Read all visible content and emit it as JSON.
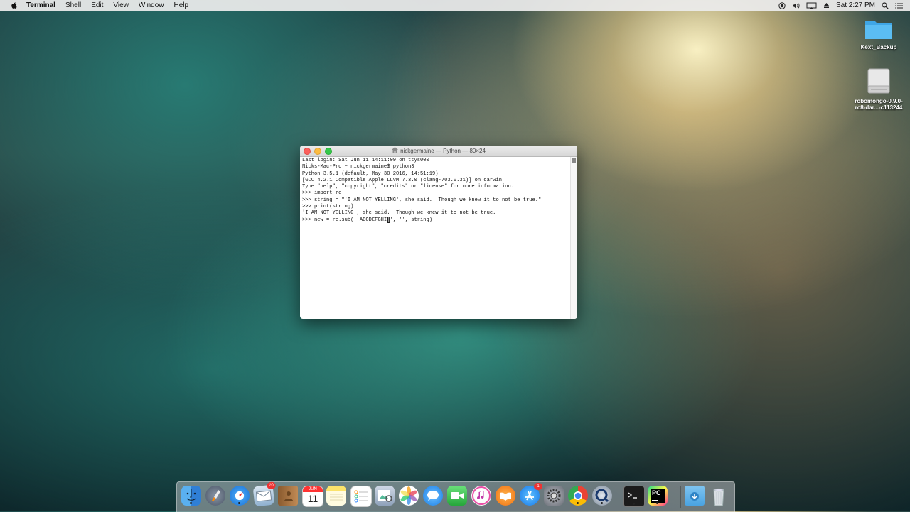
{
  "menubar": {
    "app_name": "Terminal",
    "menus": [
      "Shell",
      "Edit",
      "View",
      "Window",
      "Help"
    ],
    "clock": "Sat 2:27 PM"
  },
  "desktop": {
    "icons": [
      {
        "label": "Kext_Backup"
      },
      {
        "label_line1": "robomongo-0.9.0-",
        "label_line2": "rc8-dar...-c113244"
      }
    ]
  },
  "terminal": {
    "title": "nickgermaine — Python — 80×24",
    "lines": [
      "Last login: Sat Jun 11 14:11:09 on ttys000",
      "Nicks-Mac-Pro:~ nickgermaine$ python3",
      "Python 3.5.1 (default, May 30 2016, 14:51:19)",
      "[GCC 4.2.1 Compatible Apple LLVM 7.3.0 (clang-703.0.31)] on darwin",
      "Type \"help\", \"copyright\", \"credits\" or \"license\" for more information.",
      ">>> import re",
      ">>> string = \"'I AM NOT YELLING', she said.  Though we knew it to not be true.\"",
      ">>> print(string)",
      "'I AM NOT YELLING', she said.  Though we knew it to not be true."
    ],
    "current_line_before_cursor": ">>> new = re.sub('[ABCDEFGHI",
    "cursor_char": "]",
    "current_line_after_cursor": "', '', string)"
  },
  "dock": {
    "items": [
      {
        "name": "Finder",
        "icon": "finder-icon",
        "running": true
      },
      {
        "name": "Launchpad",
        "icon": "launchpad-icon",
        "running": false
      },
      {
        "name": "Safari",
        "icon": "safari-icon",
        "running": true
      },
      {
        "name": "Mail",
        "icon": "mail-icon",
        "running": false,
        "badge": "70"
      },
      {
        "name": "Contacts",
        "icon": "contacts-icon",
        "running": false
      },
      {
        "name": "Calendar",
        "icon": "calendar-icon",
        "running": false,
        "month": "JUN",
        "day": "11"
      },
      {
        "name": "Notes",
        "icon": "notes-icon",
        "running": false
      },
      {
        "name": "Reminders",
        "icon": "reminders-icon",
        "running": false
      },
      {
        "name": "Preview",
        "icon": "preview-icon",
        "running": false
      },
      {
        "name": "Photos",
        "icon": "photos-icon",
        "running": false
      },
      {
        "name": "Messages",
        "icon": "messages-icon",
        "running": false
      },
      {
        "name": "FaceTime",
        "icon": "facetime-icon",
        "running": false
      },
      {
        "name": "iTunes",
        "icon": "itunes-icon",
        "running": false
      },
      {
        "name": "iBooks",
        "icon": "ibooks-icon",
        "running": false
      },
      {
        "name": "App Store",
        "icon": "appstore-icon",
        "running": false,
        "badge": "1"
      },
      {
        "name": "System Preferences",
        "icon": "sysprefs-icon",
        "running": false
      },
      {
        "name": "Chrome",
        "icon": "chrome-icon",
        "running": true
      },
      {
        "name": "QuickTime",
        "icon": "quicktime-icon",
        "running": true
      },
      {
        "name": "Terminal",
        "icon": "terminal-icon",
        "running": true
      },
      {
        "name": "PyCharm",
        "icon": "pycharm-icon",
        "running": true
      },
      {
        "name": "Downloads",
        "icon": "downloads-folder-icon",
        "running": false
      },
      {
        "name": "Trash",
        "icon": "trash-icon",
        "running": false
      }
    ]
  },
  "colors": {
    "close": "#fc605c",
    "minimize": "#fdbc40",
    "zoom": "#34c84a"
  }
}
